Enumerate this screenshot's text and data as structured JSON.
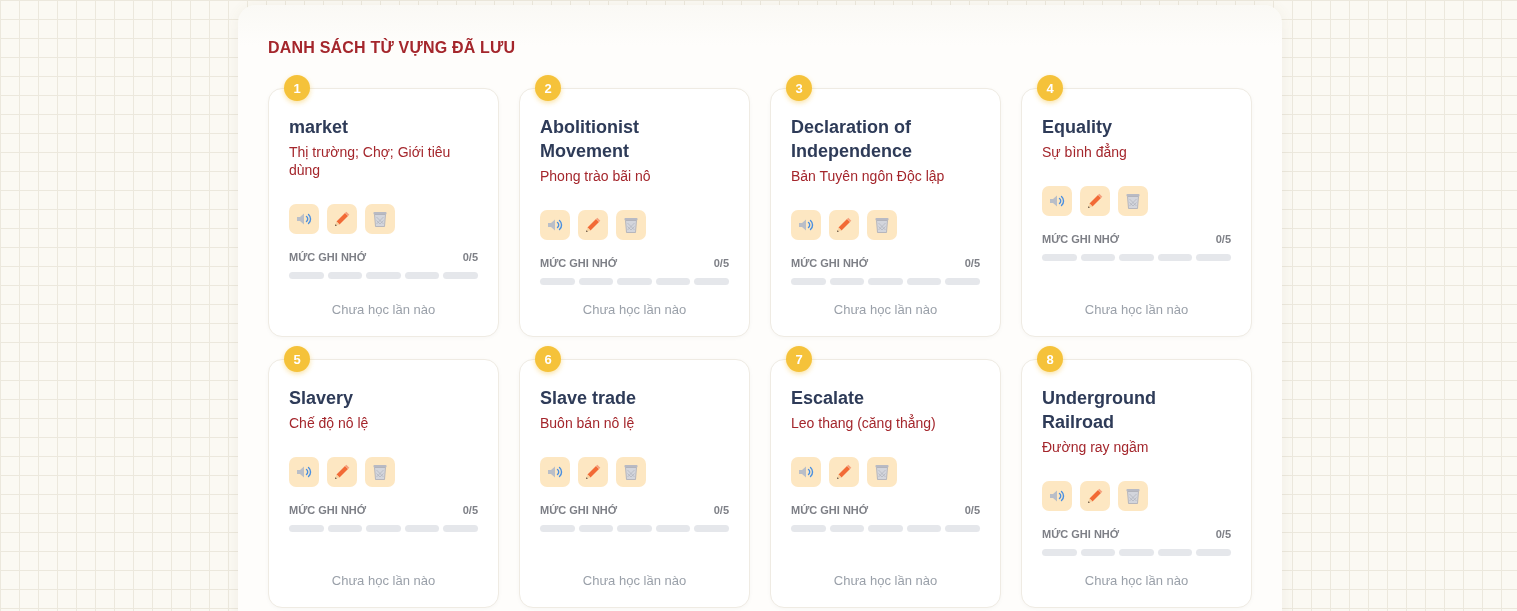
{
  "title": "DANH SÁCH TỪ VỰNG ĐÃ LƯU",
  "cards": [
    {
      "number": "1",
      "word": "market",
      "meaning": "Thị trường; Chợ; Giới tiêu dùng",
      "memory_label": "MỨC GHI NHỚ",
      "memory_count": "0/5",
      "segments": [
        {
          "filled": false
        },
        {
          "filled": false
        },
        {
          "filled": false
        },
        {
          "filled": false
        },
        {
          "filled": false
        }
      ],
      "status": "Chưa học lần nào"
    },
    {
      "number": "2",
      "word": "Abolitionist Movement",
      "meaning": "Phong trào bãi nô",
      "memory_label": "MỨC GHI NHỚ",
      "memory_count": "0/5",
      "segments": [
        {
          "filled": false
        },
        {
          "filled": false
        },
        {
          "filled": false
        },
        {
          "filled": false
        },
        {
          "filled": false
        }
      ],
      "status": "Chưa học lần nào"
    },
    {
      "number": "3",
      "word": "Declaration of Independence",
      "meaning": "Bản Tuyên ngôn Độc lập",
      "memory_label": "MỨC GHI NHỚ",
      "memory_count": "0/5",
      "segments": [
        {
          "filled": false
        },
        {
          "filled": false
        },
        {
          "filled": false
        },
        {
          "filled": false
        },
        {
          "filled": false
        }
      ],
      "status": "Chưa học lần nào"
    },
    {
      "number": "4",
      "word": "Equality",
      "meaning": "Sự bình đẳng",
      "memory_label": "MỨC GHI NHỚ",
      "memory_count": "0/5",
      "segments": [
        {
          "filled": false
        },
        {
          "filled": false
        },
        {
          "filled": false
        },
        {
          "filled": false
        },
        {
          "filled": false
        }
      ],
      "status": "Chưa học lần nào"
    },
    {
      "number": "5",
      "word": "Slavery",
      "meaning": "Chế độ nô lệ",
      "memory_label": "MỨC GHI NHỚ",
      "memory_count": "0/5",
      "segments": [
        {
          "filled": false
        },
        {
          "filled": false
        },
        {
          "filled": false
        },
        {
          "filled": false
        },
        {
          "filled": false
        }
      ],
      "status": "Chưa học lần nào"
    },
    {
      "number": "6",
      "word": "Slave trade",
      "meaning": "Buôn bán nô lệ",
      "memory_label": "MỨC GHI NHỚ",
      "memory_count": "0/5",
      "segments": [
        {
          "filled": false
        },
        {
          "filled": false
        },
        {
          "filled": false
        },
        {
          "filled": false
        },
        {
          "filled": false
        }
      ],
      "status": "Chưa học lần nào"
    },
    {
      "number": "7",
      "word": "Escalate",
      "meaning": "Leo thang (căng thẳng)",
      "memory_label": "MỨC GHI NHỚ",
      "memory_count": "0/5",
      "segments": [
        {
          "filled": false
        },
        {
          "filled": false
        },
        {
          "filled": false
        },
        {
          "filled": false
        },
        {
          "filled": false
        }
      ],
      "status": "Chưa học lần nào"
    },
    {
      "number": "8",
      "word": "Underground Railroad",
      "meaning": "Đường ray ngầm",
      "memory_label": "MỨC GHI NHỚ",
      "memory_count": "0/5",
      "segments": [
        {
          "filled": false
        },
        {
          "filled": false
        },
        {
          "filled": false
        },
        {
          "filled": false
        },
        {
          "filled": false
        }
      ],
      "status": "Chưa học lần nào"
    }
  ]
}
